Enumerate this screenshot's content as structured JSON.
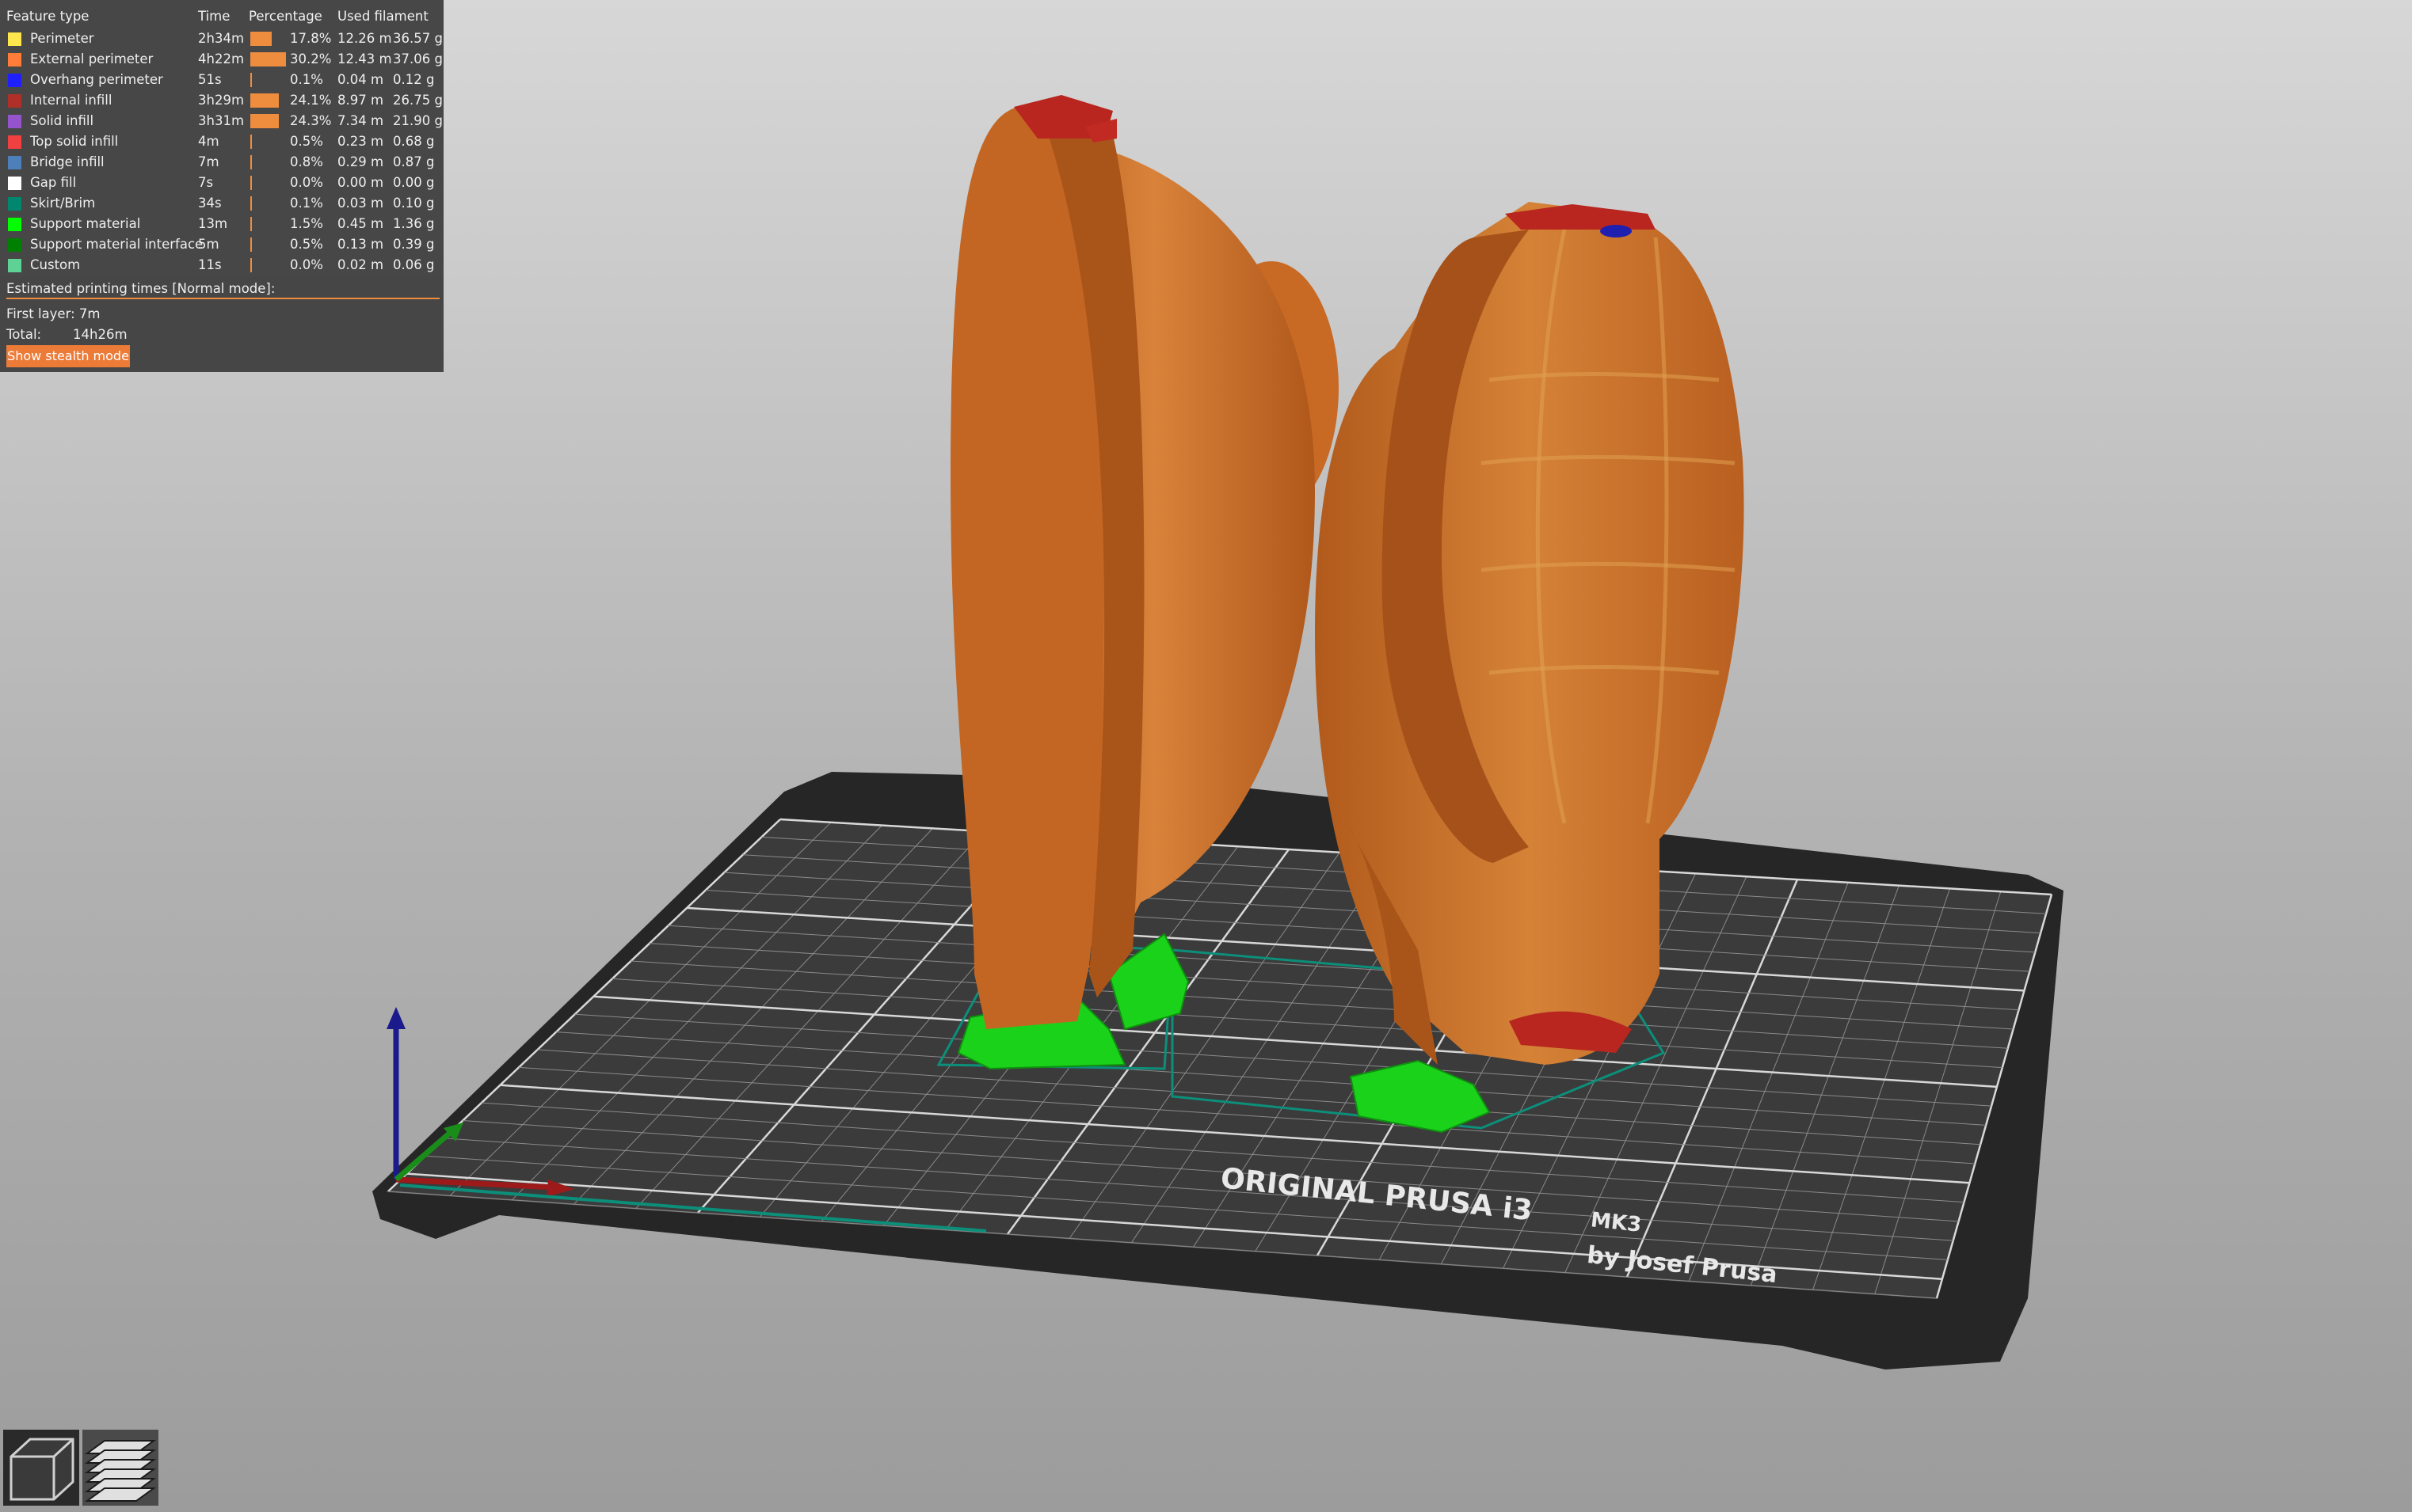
{
  "legend": {
    "headers": {
      "feature_type": "Feature type",
      "time": "Time",
      "percentage": "Percentage",
      "used_filament": "Used filament"
    },
    "rows": [
      {
        "name": "Perimeter",
        "time": "2h34m",
        "percentage": "17.8%",
        "fraction": 0.178,
        "length": "12.26 m",
        "weight": "36.57 g",
        "color": "#ffe64d"
      },
      {
        "name": "External perimeter",
        "time": "4h22m",
        "percentage": "30.2%",
        "fraction": 0.302,
        "length": "12.43 m",
        "weight": "37.06 g",
        "color": "#ff7d38"
      },
      {
        "name": "Overhang perimeter",
        "time": "51s",
        "percentage": "0.1%",
        "fraction": 0.001,
        "length": "0.04 m",
        "weight": "0.12 g",
        "color": "#1f1fff"
      },
      {
        "name": "Internal infill",
        "time": "3h29m",
        "percentage": "24.1%",
        "fraction": 0.241,
        "length": "8.97 m",
        "weight": "26.75 g",
        "color": "#b03029"
      },
      {
        "name": "Solid infill",
        "time": "3h31m",
        "percentage": "24.3%",
        "fraction": 0.243,
        "length": "7.34 m",
        "weight": "21.90 g",
        "color": "#9654cc"
      },
      {
        "name": "Top solid infill",
        "time": "4m",
        "percentage": "0.5%",
        "fraction": 0.005,
        "length": "0.23 m",
        "weight": "0.68 g",
        "color": "#f04040"
      },
      {
        "name": "Bridge infill",
        "time": "7m",
        "percentage": "0.8%",
        "fraction": 0.008,
        "length": "0.29 m",
        "weight": "0.87 g",
        "color": "#4d80ba"
      },
      {
        "name": "Gap fill",
        "time": "7s",
        "percentage": "0.0%",
        "fraction": 0.0,
        "length": "0.00 m",
        "weight": "0.00 g",
        "color": "#ffffff"
      },
      {
        "name": "Skirt/Brim",
        "time": "34s",
        "percentage": "0.1%",
        "fraction": 0.001,
        "length": "0.03 m",
        "weight": "0.10 g",
        "color": "#00876e"
      },
      {
        "name": "Support material",
        "time": "13m",
        "percentage": "1.5%",
        "fraction": 0.015,
        "length": "0.45 m",
        "weight": "1.36 g",
        "color": "#00ff00"
      },
      {
        "name": "Support material interface",
        "time": "5m",
        "percentage": "0.5%",
        "fraction": 0.005,
        "length": "0.13 m",
        "weight": "0.39 g",
        "color": "#008000"
      },
      {
        "name": "Custom",
        "time": "11s",
        "percentage": "0.0%",
        "fraction": 0.0,
        "length": "0.02 m",
        "weight": "0.06 g",
        "color": "#5ed194"
      }
    ],
    "estimated_title": "Estimated printing times [Normal mode]:",
    "first_layer_label": "First layer:",
    "first_layer_value": "7m",
    "total_label": "Total:",
    "total_value": "14h26m",
    "stealth_button": "Show stealth mode"
  },
  "bed": {
    "label_line1": "ORIGINAL PRUSA i3",
    "label_model": "MK3",
    "label_line2": "by Josef Prusa"
  },
  "colors": {
    "model": "#c96a24",
    "model_light": "#d98a3c",
    "support": "#1ed61e",
    "skirt": "#00876e",
    "bed": "#3a3a3a",
    "bed_frame": "#2a2a2a"
  },
  "view_buttons": [
    {
      "name": "3d-view-icon"
    },
    {
      "name": "preview-layers-icon"
    }
  ]
}
